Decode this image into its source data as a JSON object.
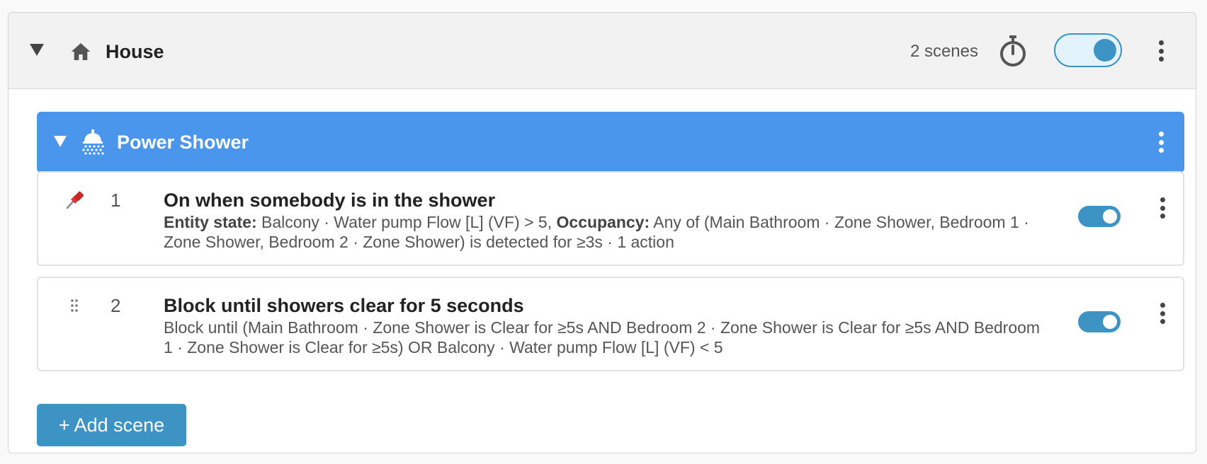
{
  "header": {
    "title": "House",
    "icon": "home-icon",
    "scene_count": "2 scenes",
    "timer_icon": "timer-icon",
    "enabled": true
  },
  "group": {
    "title": "Power Shower",
    "icon": "shower-icon",
    "color": "#4a96ec"
  },
  "scenes": [
    {
      "number": "1",
      "title": "On when somebody is in the shower",
      "handle_icon": "pin-icon",
      "enabled": true,
      "description": [
        {
          "label": "Entity state:",
          "text": " Balcony · Water pump Flow [L] (VF) > 5, "
        },
        {
          "label": "Occupancy:",
          "text": " Any of (Main Bathroom · Zone Shower, Bedroom 1 · Zone Shower, Bedroom 2 · Zone Shower) is detected for ≥3s · 1 action"
        }
      ]
    },
    {
      "number": "2",
      "title": "Block until showers clear for 5 seconds",
      "handle_icon": "drag-handle-icon",
      "enabled": true,
      "description": [
        {
          "label": "",
          "text": "Block until (Main Bathroom · Zone Shower is Clear for ≥5s AND Bedroom 2 · Zone Shower is Clear for ≥5s AND Bedroom 1 · Zone Shower is Clear for ≥5s) OR Balcony · Water pump Flow [L] (VF) < 5"
        }
      ]
    }
  ],
  "add_button_label": "+ Add scene",
  "colors": {
    "accent": "#3d94c4",
    "group_bar": "#4a96ec",
    "header_bg": "#f2f2f2"
  }
}
